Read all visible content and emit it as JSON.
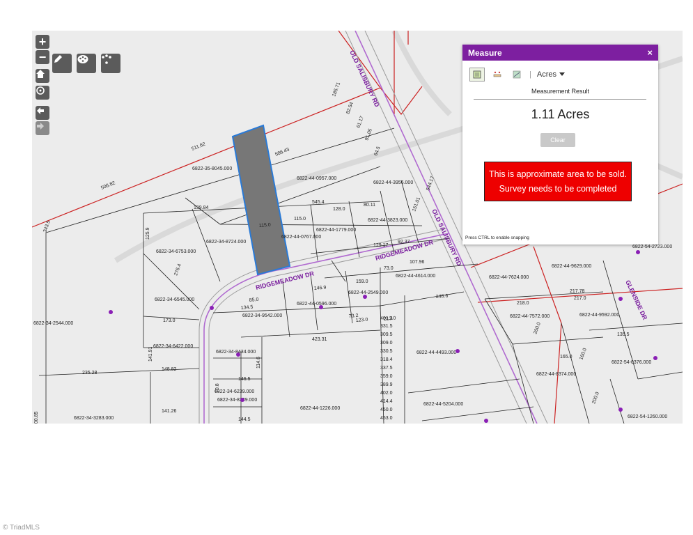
{
  "map": {
    "road_labels": [
      "OLD SALISBURY RD",
      "OLD SALISBURY RD",
      "RIDGEMEADOW DR",
      "RIDGEMEADOW DR",
      "GLENSIDE DR"
    ],
    "parcels": [
      "6822-35-8045.000",
      "6822-44-0957.000",
      "6822-44-3956.000",
      "6822-44-3823.000",
      "6822-44-1779.000",
      "6822-44-0767.000",
      "6822-34-8724.000",
      "6822-34-6753.000",
      "6822-34-6545.000",
      "6822-34-2544.000",
      "6822-34-6422.000",
      "6822-34-8434.000",
      "6822-34-6239.000",
      "6822-34-3283.000",
      "6822-34-8239.000",
      "6822-34-9542.000",
      "6822-44-0596.000",
      "6822-44-2549.000",
      "6822-44-4614.000",
      "6822-44-4493.000",
      "6822-44-1226.000",
      "6822-44-5204.000",
      "6822-44-7624.000",
      "6822-44-7572.000",
      "6822-44-9629.000",
      "6822-44-9592.000",
      "6822-54-0376.000",
      "6822-44-8374.000",
      "6822-54-1260.000",
      "6822-54-2723.000"
    ],
    "dims": [
      "511.62",
      "506.82",
      "343.5",
      "185.71",
      "82.54",
      "61.17",
      "91.05",
      "64.5",
      "586.43",
      "115.0",
      "545.4",
      "115.0",
      "128.0",
      "80.11",
      "139.84",
      "125.9",
      "276.4",
      "173.0",
      "151.01",
      "544.17",
      "129.17",
      "92.37",
      "73.0",
      "107.96",
      "159.0",
      "85.0",
      "146.9",
      "134.5",
      "73.2",
      "123.0",
      "213.0",
      "248.6",
      "401.3",
      "331.5",
      "309.5",
      "309.0",
      "330.5",
      "318.4",
      "337.5",
      "359.0",
      "389.9",
      "402.0",
      "414.4",
      "450.0",
      "453.0",
      "423.31",
      "218.0",
      "217.0",
      "217.78",
      "240.0",
      "200.0",
      "165.0",
      "160.0",
      "200.0",
      "135.5",
      "70.8",
      "146.5",
      "144.5",
      "114.6",
      "235.28",
      "141.91",
      "148.82",
      "141.26",
      "200.85"
    ]
  },
  "tools": {
    "zoom_in": "+",
    "zoom_out": "−"
  },
  "measure": {
    "title": "Measure",
    "close": "×",
    "unit": "Acres",
    "separator": "|",
    "result_label": "Measurement Result",
    "result_value": "1.11 Acres",
    "clear": "Clear",
    "note": "This is approximate area to be sold.  Survey needs to be completed",
    "hint": "Press CTRL to enable snapping"
  },
  "footer": {
    "copyright": "© TriadMLS"
  },
  "colors": {
    "accent": "#7d1fa0",
    "parcel_line": "#cc2222",
    "road": "#b06ad0",
    "highlight": "#777777",
    "highlight_border": "#2a7ad6",
    "note_bg": "#ee0000"
  }
}
